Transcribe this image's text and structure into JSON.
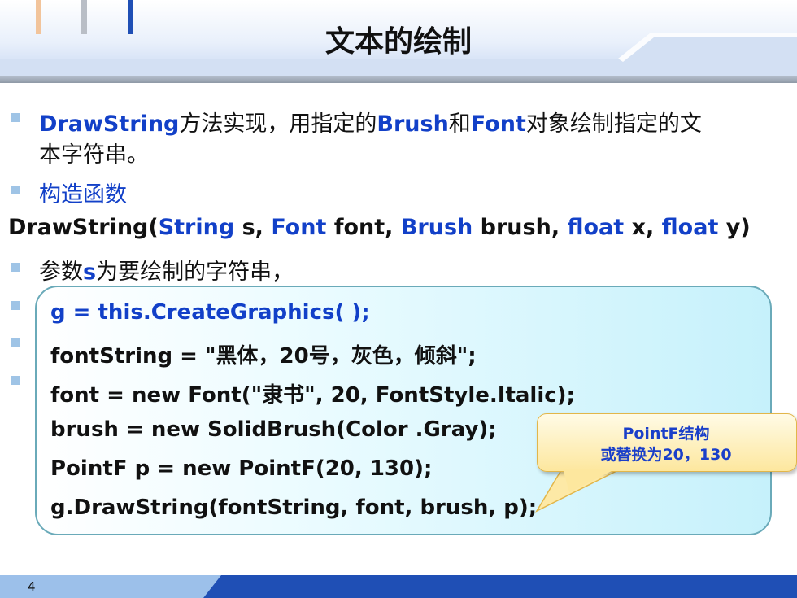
{
  "header": {
    "title": "文本的绘制"
  },
  "bullets": {
    "b1": {
      "method": "DrawString",
      "text1": "方法实现，用指定的",
      "brush": "Brush",
      "and": "和",
      "font": "Font",
      "text2": "对象绘制指定的文",
      "cont": "本字符串。"
    },
    "b2": {
      "label": "构造函数"
    }
  },
  "signature": {
    "name": "DrawString(",
    "type1": "String",
    "arg1": " s, ",
    "type2": "Font",
    "arg2": " font, ",
    "type3": "Brush",
    "arg3": " brush, ",
    "type4": "float",
    "arg4": " x, ",
    "type5": "float",
    "arg5": " y)"
  },
  "params": {
    "p1_pre": "参数",
    "p1_s": "s",
    "p1_post": "为要绘制的字符串，"
  },
  "code": {
    "lines": [
      "g = this.CreateGraphics( );",
      "fontString = \"黑体，20号，灰色，倾斜\";",
      "font = new Font(\"隶书\", 20, FontStyle.Italic);",
      "brush = new SolidBrush(Color .Gray);",
      "PointF p = new PointF(20, 130);",
      "g.DrawString(fontString, font, brush, p);"
    ]
  },
  "callout": {
    "line1": "PointF结构",
    "line2": "或替换为20，130"
  },
  "footer": {
    "page": "4"
  },
  "colors": {
    "keyword_blue": "#1240c8",
    "footer_blue": "#1f4fb5",
    "bullet": "#9fc4e6"
  }
}
